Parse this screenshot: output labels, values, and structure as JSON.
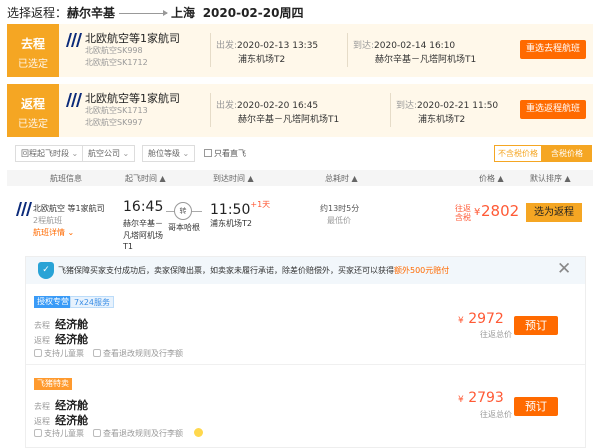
{
  "header": {
    "prefix": "选择返程：",
    "from": "赫尔辛基",
    "to": "上海",
    "date": "2020-02-20周四"
  },
  "legs": [
    {
      "tag": "去程",
      "status": "已选定",
      "airline": "北欧航空等1家航司",
      "flights": [
        "北欧航空SK998",
        "北欧航空SK1712"
      ],
      "dep_key": "出发:",
      "dep_time": "2020-02-13 13:35",
      "dep_ap": "浦东机场T2",
      "arr_key": "到达:",
      "arr_time": "2020-02-14 16:10",
      "arr_ap": "赫尔辛基－凡塔阿机场T1",
      "button": "重选去程航班"
    },
    {
      "tag": "返程",
      "status": "已选定",
      "airline": "北欧航空等1家航司",
      "flights": [
        "北欧航空SK1713",
        "北欧航空SK997"
      ],
      "dep_key": "出发:",
      "dep_time": "2020-02-20 16:45",
      "dep_ap": "赫尔辛基－凡塔阿机场T1",
      "arr_key": "到达:",
      "arr_time": "2020-02-21 11:50",
      "arr_ap": "浦东机场T2",
      "button": "重选返程航班"
    }
  ],
  "filters": [
    "回程起飞时段",
    "航空公司",
    "舱位等级"
  ],
  "direct_only": "只看直飞",
  "price_toggle": [
    "不含税价格",
    "含税价格"
  ],
  "columns": [
    "航班信息",
    "起飞时间 ▲",
    "到达时间 ▲",
    "总耗时 ▲",
    "价格 ▲",
    "默认排序 ▲"
  ],
  "flight": {
    "airline": "北欧航空 等1家航司",
    "share": "2程航班",
    "details": "航班详情 ⌄",
    "dep_time": "16:45",
    "dep_ap": [
      "赫尔辛基－",
      "凡塔阿机场",
      "T1"
    ],
    "stop": "转",
    "stop_city": "哥本哈根",
    "arr_time": "11:50",
    "arr_plus": "+1天",
    "arr_ap": "浦东机场T2",
    "duration": "约13时5分",
    "duration_note": "最低价",
    "price_lbl1": "往返",
    "price_lbl2": "含税",
    "price_cur": "¥",
    "price": "2802",
    "button": "选为返程"
  },
  "notice": {
    "text": "飞猪保障买家支付成功后，卖家保障出票，如卖家未履行承诺，除差价赔偿外，买家还可以获得",
    "highlight": "额外500元赔付",
    "shield": "✓"
  },
  "offers": [
    {
      "badges": [
        "授权专营",
        "7x24服务"
      ],
      "legs": [
        {
          "lbl": "去程",
          "cls": "经济舱"
        },
        {
          "lbl": "返程",
          "cls": "经济舱"
        }
      ],
      "notes": [
        "支持儿童票",
        "查看退改规则及行李额"
      ],
      "cur": "¥",
      "price": "2972",
      "rt": "往返总价",
      "book": "预订"
    },
    {
      "badges": [
        "飞猪特卖"
      ],
      "legs": [
        {
          "lbl": "去程",
          "cls": "经济舱"
        },
        {
          "lbl": "返程",
          "cls": "经济舱"
        }
      ],
      "notes": [
        "支持儿童票",
        "查看退改规则及行李额"
      ],
      "cur": "¥",
      "price": "2793",
      "rt": "往返总价",
      "book": "预订"
    }
  ],
  "colors": {
    "accent": "#f5a623",
    "action": "#ff6a00",
    "price": "#ff5a36"
  }
}
